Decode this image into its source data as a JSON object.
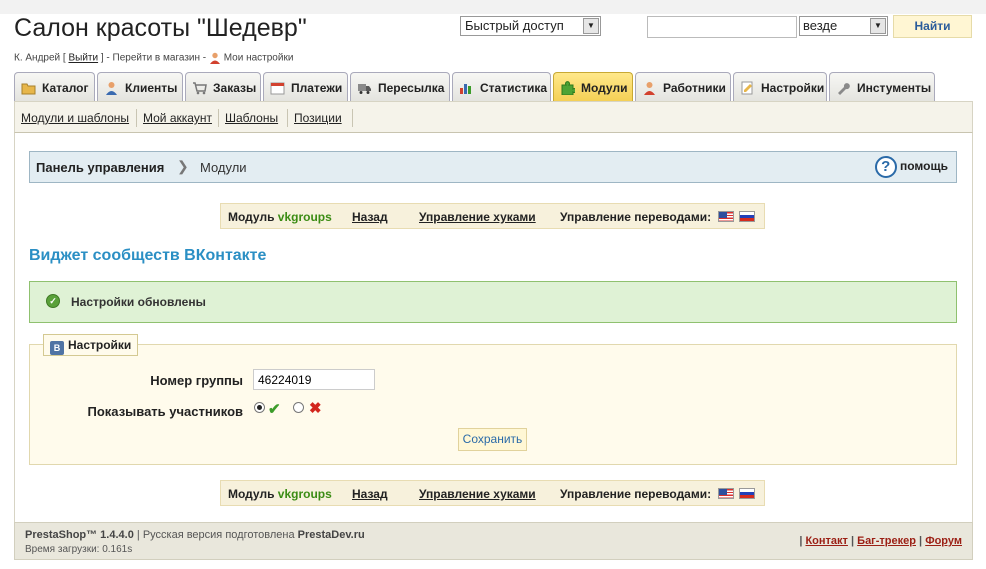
{
  "header": {
    "shop_title": "Салон красоты \"Шедевр\"",
    "user_name": "К. Андрей",
    "logout": "Выйти",
    "goto_shop": "Перейти в магазин",
    "my_settings": "Мои настройки",
    "quick_access": "Быстрый доступ",
    "search_value": "",
    "search_scope": "везде",
    "search_button": "Найти"
  },
  "tabs": [
    {
      "label": "Каталог",
      "icon": "folder-icon"
    },
    {
      "label": "Клиенты",
      "icon": "user-icon"
    },
    {
      "label": "Заказы",
      "icon": "cart-icon"
    },
    {
      "label": "Платежи",
      "icon": "calendar-icon"
    },
    {
      "label": "Пересылка",
      "icon": "truck-icon"
    },
    {
      "label": "Статистика",
      "icon": "bar-chart-icon"
    },
    {
      "label": "Модули",
      "icon": "puzzle-icon",
      "active": true
    },
    {
      "label": "Работники",
      "icon": "employee-icon"
    },
    {
      "label": "Настройки",
      "icon": "settings-doc-icon"
    },
    {
      "label": "Инстументы",
      "icon": "wrench-icon"
    }
  ],
  "subnav": [
    "Модули и шаблоны",
    "Мой аккаунт",
    "Шаблоны",
    "Позиции"
  ],
  "breadcrumb": {
    "home": "Панель управления",
    "current": "Модули",
    "help": "помощь"
  },
  "module_bar": {
    "label": "Модуль",
    "name": "vkgroups",
    "back": "Назад",
    "hooks": "Управление хуками",
    "translations": "Управление переводами:"
  },
  "page_heading": "Виджет сообществ ВКонтакте",
  "success_message": "Настройки обновлены",
  "settings": {
    "legend": "Настройки",
    "vk_icon": "B",
    "group_label": "Номер группы",
    "group_value": "46224019",
    "members_label": "Показывать участников",
    "members_on": true,
    "save": "Сохранить"
  },
  "footer": {
    "brand": "PrestaShop™ 1.4.4.0",
    "rus_text": "Русская версия подготовлена",
    "rus_site": "PrestaDev.ru",
    "load_time": "Время загрузки: 0.161s",
    "links": [
      "Контакт",
      "Баг-трекер",
      "Форум"
    ]
  },
  "colors": {
    "active_tab": "#f4cf54",
    "heading": "#2b8fc4",
    "success_bg": "#dff2d5",
    "module_name": "#3b8c14"
  }
}
